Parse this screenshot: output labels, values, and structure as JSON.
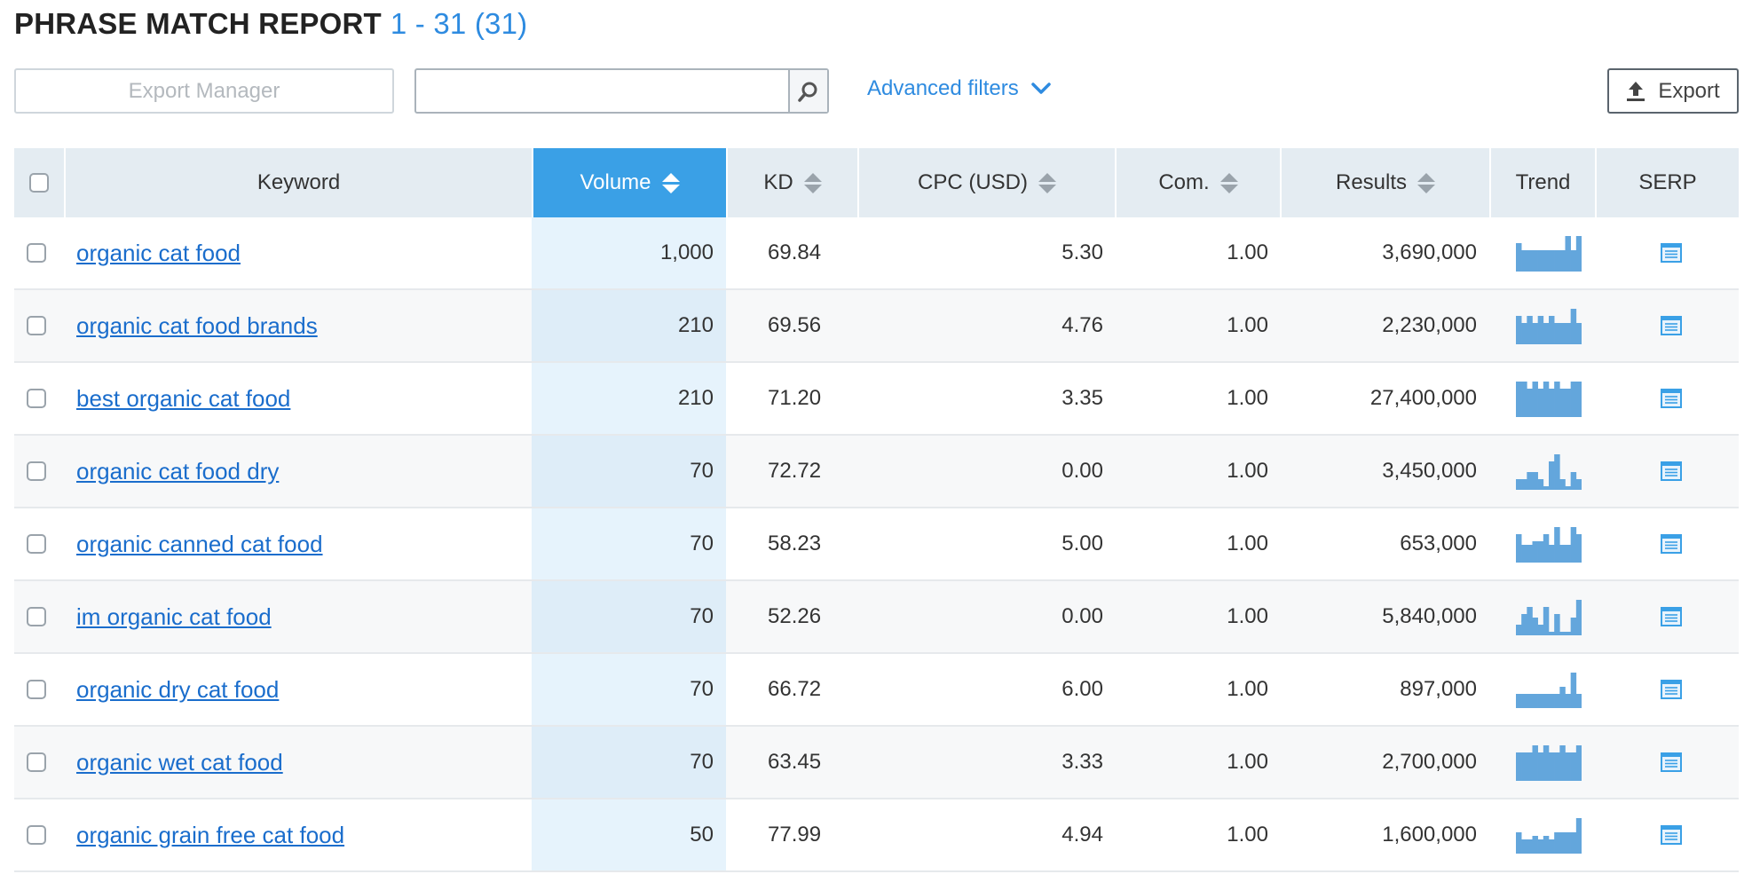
{
  "header": {
    "title": "PHRASE MATCH REPORT",
    "range": "1 - 31 (31)"
  },
  "toolbar": {
    "export_manager_label": "Export Manager",
    "search_value": "",
    "advanced_filters_label": "Advanced filters",
    "export_label": "Export"
  },
  "table": {
    "columns": [
      "Keyword",
      "Volume",
      "KD",
      "CPC (USD)",
      "Com.",
      "Results",
      "Trend",
      "SERP"
    ],
    "sorted_column": "Volume",
    "accent_color": "#3aa0e6",
    "link_color": "#1a6dcc",
    "rows": [
      {
        "keyword": "organic cat food",
        "volume": "1,000",
        "kd": "69.84",
        "cpc": "5.30",
        "com": "1.00",
        "results": "3,690,000",
        "trend": [
          0.8,
          0.6,
          0.6,
          0.6,
          0.6,
          0.6,
          0.6,
          0.6,
          0.6,
          1,
          0.6,
          1
        ]
      },
      {
        "keyword": "organic cat food brands",
        "volume": "210",
        "kd": "69.56",
        "cpc": "4.76",
        "com": "1.00",
        "results": "2,230,000",
        "trend": [
          0.8,
          0.6,
          0.8,
          0.6,
          0.8,
          0.6,
          0.8,
          0.6,
          0.6,
          0.6,
          1,
          0.6
        ]
      },
      {
        "keyword": "best organic cat food",
        "volume": "210",
        "kd": "71.20",
        "cpc": "3.35",
        "com": "1.00",
        "results": "27,400,000",
        "trend": [
          1,
          1,
          0.8,
          1,
          0.8,
          1,
          0.8,
          1,
          0.8,
          0.8,
          1,
          1
        ]
      },
      {
        "keyword": "organic cat food dry",
        "volume": "70",
        "kd": "72.72",
        "cpc": "0.00",
        "com": "1.00",
        "results": "3,450,000",
        "trend": [
          0.3,
          0.3,
          0.5,
          0.5,
          0.3,
          0.1,
          0.8,
          1,
          0.3,
          0.1,
          0.5,
          0.3
        ]
      },
      {
        "keyword": "organic canned cat food",
        "volume": "70",
        "kd": "58.23",
        "cpc": "5.00",
        "com": "1.00",
        "results": "653,000",
        "trend": [
          0.8,
          0.5,
          0.5,
          0.6,
          0.6,
          0.8,
          0.5,
          1,
          0.5,
          0.5,
          1,
          0.8
        ]
      },
      {
        "keyword": "im organic cat food",
        "volume": "70",
        "kd": "52.26",
        "cpc": "0.00",
        "com": "1.00",
        "results": "5,840,000",
        "trend": [
          0.3,
          0.6,
          0.8,
          0.5,
          0.3,
          0.8,
          0.1,
          0.6,
          0.1,
          0.1,
          0.5,
          1
        ]
      },
      {
        "keyword": "organic dry cat food",
        "volume": "70",
        "kd": "66.72",
        "cpc": "6.00",
        "com": "1.00",
        "results": "897,000",
        "trend": [
          0.4,
          0.4,
          0.4,
          0.4,
          0.4,
          0.4,
          0.4,
          0.4,
          0.6,
          0.4,
          1,
          0.4
        ]
      },
      {
        "keyword": "organic wet cat food",
        "volume": "70",
        "kd": "63.45",
        "cpc": "3.33",
        "com": "1.00",
        "results": "2,700,000",
        "trend": [
          0.8,
          0.8,
          0.8,
          1,
          0.8,
          1,
          0.8,
          0.8,
          1,
          0.8,
          0.8,
          1
        ]
      },
      {
        "keyword": "organic grain free cat food",
        "volume": "50",
        "kd": "77.99",
        "cpc": "4.94",
        "com": "1.00",
        "results": "1,600,000",
        "trend": [
          0.6,
          0.4,
          0.4,
          0.5,
          0.4,
          0.5,
          0.4,
          0.6,
          0.6,
          0.6,
          0.6,
          1
        ]
      }
    ]
  }
}
